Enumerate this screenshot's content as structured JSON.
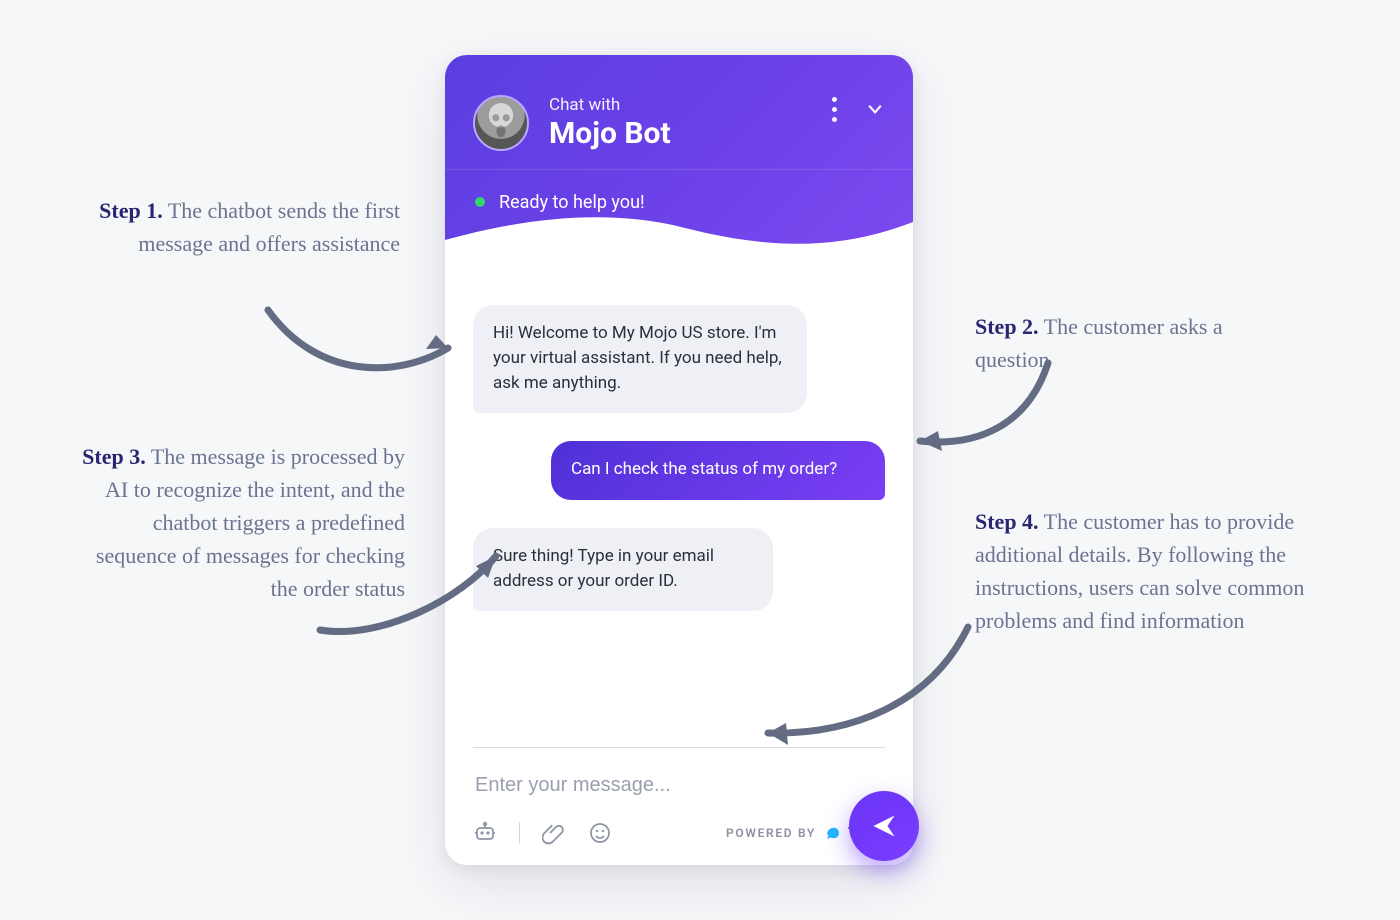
{
  "header": {
    "chat_with_label": "Chat with",
    "bot_name": "Mojo Bot",
    "status_text": "Ready to help you!"
  },
  "messages": {
    "bot_greeting": "Hi! Welcome to My Mojo US store. I'm your virtual assistant. If you need help, ask me anything.",
    "user_question": "Can I check the status of my order?",
    "bot_followup": "Sure thing! Type in your email address or your order ID."
  },
  "composer": {
    "placeholder": "Enter your message...",
    "powered_label": "POWERED BY",
    "brand": "TIDIO"
  },
  "annotations": {
    "step1": {
      "label": "Step 1.",
      "text": " The chatbot sends the first message and offers assistance"
    },
    "step2": {
      "label": "Step 2.",
      "text": " The customer asks a question"
    },
    "step3": {
      "label": "Step 3.",
      "text": " The message is processed by AI to recognize the intent, and the chatbot triggers a predefined sequence of messages for checking the order status"
    },
    "step4": {
      "label": "Step 4.",
      "text": " The customer has to provide additional details. By following the instructions, users can solve common problems and find information"
    }
  }
}
